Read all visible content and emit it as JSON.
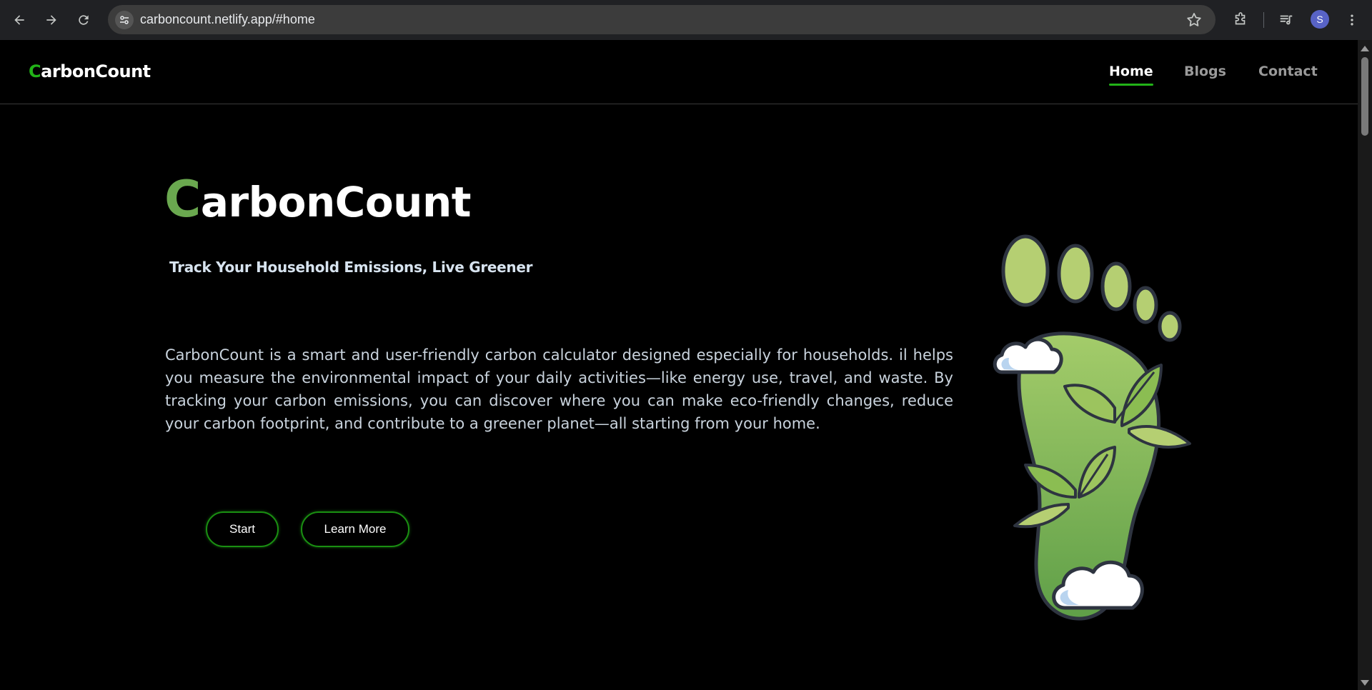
{
  "browser": {
    "url": "carboncount.netlify.app/#home",
    "profile_initial": "S"
  },
  "site": {
    "logo_first": "C",
    "logo_rest": "arbonCount",
    "nav": [
      {
        "label": "Home",
        "active": true
      },
      {
        "label": "Blogs",
        "active": false
      },
      {
        "label": "Contact",
        "active": false
      }
    ]
  },
  "hero": {
    "title_first": "C",
    "title_rest": "arbonCount",
    "tagline": "Track Your Household Emissions, Live Greener",
    "description": "CarbonCount is a smart and user-friendly carbon calculator designed especially for households. il helps you measure the environmental impact of your daily activities—like energy use, travel, and waste. By tracking your carbon emissions, you can discover where you can make eco-friendly changes, reduce your carbon footprint, and contribute to a greener planet—all starting from your home.",
    "start_label": "Start",
    "learn_more_label": "Learn More"
  },
  "colors": {
    "accent_green": "#22b318",
    "title_green": "#6aa84f",
    "background": "#000000"
  },
  "icons": [
    "back-arrow-icon",
    "forward-arrow-icon",
    "reload-icon",
    "site-settings-icon",
    "bookmark-star-icon",
    "extensions-icon",
    "media-controls-icon",
    "more-menu-icon",
    "footprint-illustration"
  ]
}
